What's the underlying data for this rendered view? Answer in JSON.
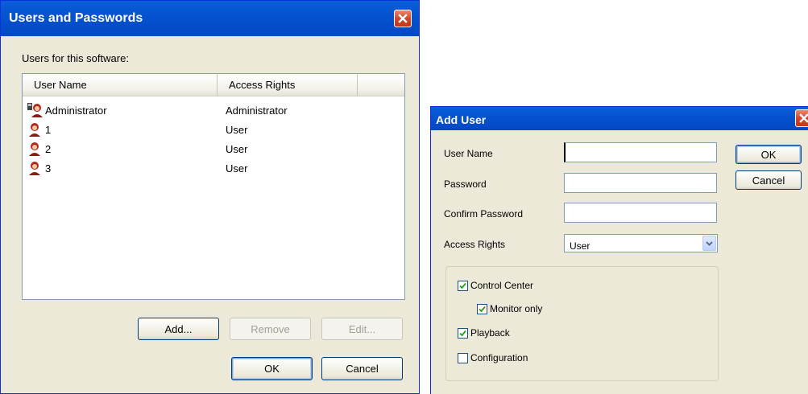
{
  "users_dialog": {
    "title": "Users and Passwords",
    "users_label": "Users for this software:",
    "columns": [
      "User Name",
      "Access Rights"
    ],
    "rows": [
      {
        "name": "Administrator",
        "rights": "Administrator",
        "icon": "admin-user-icon"
      },
      {
        "name": "1",
        "rights": "User",
        "icon": "user-icon"
      },
      {
        "name": "2",
        "rights": "User",
        "icon": "user-icon"
      },
      {
        "name": "3",
        "rights": "User",
        "icon": "user-icon"
      }
    ],
    "add_label": "Add...",
    "remove_label": "Remove",
    "edit_label": "Edit...",
    "ok_label": "OK",
    "cancel_label": "Cancel"
  },
  "add_user_dialog": {
    "title": "Add User",
    "user_name_label": "User Name",
    "password_label": "Password",
    "confirm_password_label": "Confirm Password",
    "access_rights_label": "Access Rights",
    "access_rights_value": "User",
    "user_name_value": "",
    "password_value": "",
    "confirm_password_value": "",
    "ok_label": "OK",
    "cancel_label": "Cancel",
    "permissions": {
      "control_center": {
        "label": "Control Center",
        "checked": true
      },
      "monitor_only": {
        "label": "Monitor only",
        "checked": true
      },
      "playback": {
        "label": "Playback",
        "checked": true
      },
      "configuration": {
        "label": "Configuration",
        "checked": false
      }
    }
  },
  "colors": {
    "title_bar": "#0553d0",
    "dialog_face": "#ece9d8",
    "close_button": "#d4472b"
  }
}
